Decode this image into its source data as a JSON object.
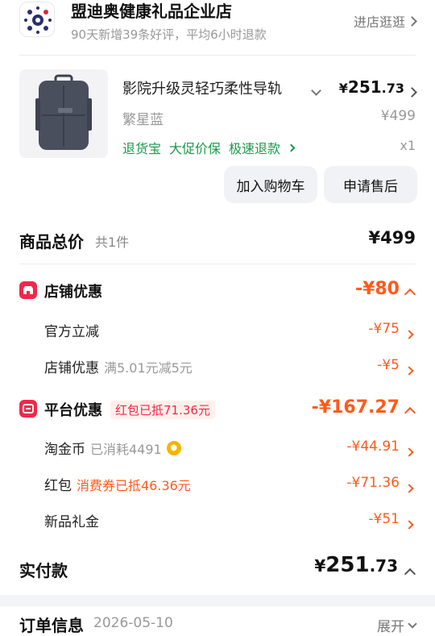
{
  "store": {
    "name": "盟迪奥健康礼品企业店",
    "subtitle": "90天新增39条好评，平均6小时退款",
    "visit_label": "进店逛逛"
  },
  "product": {
    "title": "影院升级灵轻巧柔性导轨",
    "variant": "繁星蓝",
    "price_symbol": "¥",
    "price_int": "251",
    "price_dec": ".73",
    "original_price": "¥499",
    "tags": [
      "退货宝",
      "大促价保",
      "极速退款"
    ],
    "quantity": "x1",
    "buttons": {
      "add_cart": "加入购物车",
      "after_sale": "申请售后"
    }
  },
  "summary": {
    "total_label": "商品总价",
    "total_count": "共1件",
    "total_value": "¥499"
  },
  "store_discount": {
    "label": "店铺优惠",
    "value": "-¥80",
    "items": [
      {
        "label": "官方立减",
        "note": "",
        "value": "-¥75"
      },
      {
        "label": "店铺优惠",
        "note": "满5.01元减5元",
        "value": "-¥5"
      }
    ]
  },
  "platform_discount": {
    "label": "平台优惠",
    "badge": "红包已抵71.36元",
    "value": "-¥167.27",
    "items": [
      {
        "label": "淘金币",
        "note": "已消耗4491",
        "value": "-¥44.91"
      },
      {
        "label": "红包",
        "note": "消费券已抵46.36元",
        "value": "-¥71.36"
      },
      {
        "label": "新品礼金",
        "note": "",
        "value": "-¥51"
      }
    ]
  },
  "payment": {
    "label": "实付款",
    "symbol": "¥",
    "int": "251",
    "dec": ".73"
  },
  "order": {
    "label": "订单信息",
    "date": "2026-05-10",
    "expand_label": "展开"
  },
  "colors": {
    "accent_orange": "#ff5a1a",
    "accent_red": "#f0284a",
    "tag_green": "#1a9a4a"
  }
}
